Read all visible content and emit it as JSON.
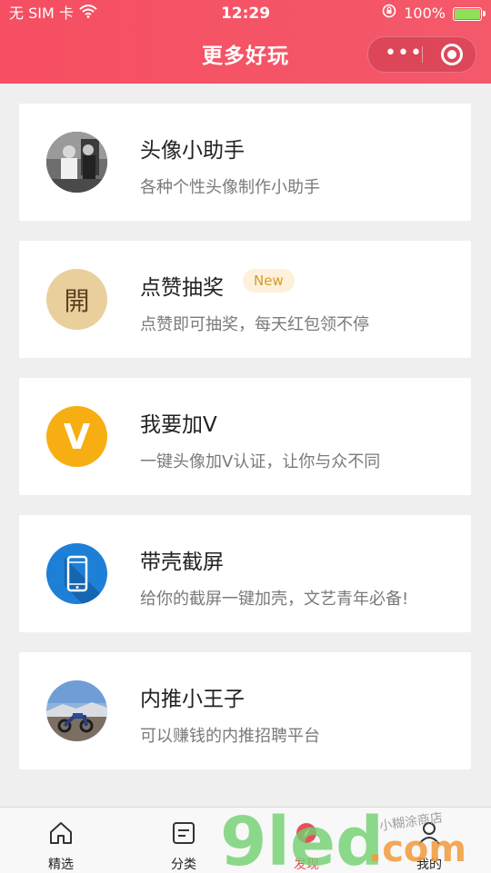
{
  "status_bar": {
    "carrier": "无 SIM 卡",
    "time": "12:29",
    "battery": "100%"
  },
  "header": {
    "title": "更多好玩"
  },
  "cards": [
    {
      "name": "头像小助手",
      "desc": "各种个性头像制作小助手"
    },
    {
      "name": "点赞抽奖",
      "badge": "New",
      "desc": "点赞即可抽奖，每天红包领不停",
      "avatar_text": "開"
    },
    {
      "name": "我要加V",
      "desc": "一键头像加V认证，让你与众不同",
      "avatar_text": "V"
    },
    {
      "name": "带壳截屏",
      "desc": "给你的截屏一键加壳，文艺青年必备!"
    },
    {
      "name": "内推小王子",
      "desc": "可以赚钱的内推招聘平台"
    }
  ],
  "tabbar": [
    {
      "label": "精选"
    },
    {
      "label": "分类"
    },
    {
      "label": "发现"
    },
    {
      "label": "我的"
    }
  ],
  "watermark": {
    "text": "9led.com",
    "subtitle": "小糊涂商店"
  },
  "colors": {
    "header": "#f64e62",
    "badge_text": "#d59a2b",
    "tab_active": "#e8505b"
  }
}
